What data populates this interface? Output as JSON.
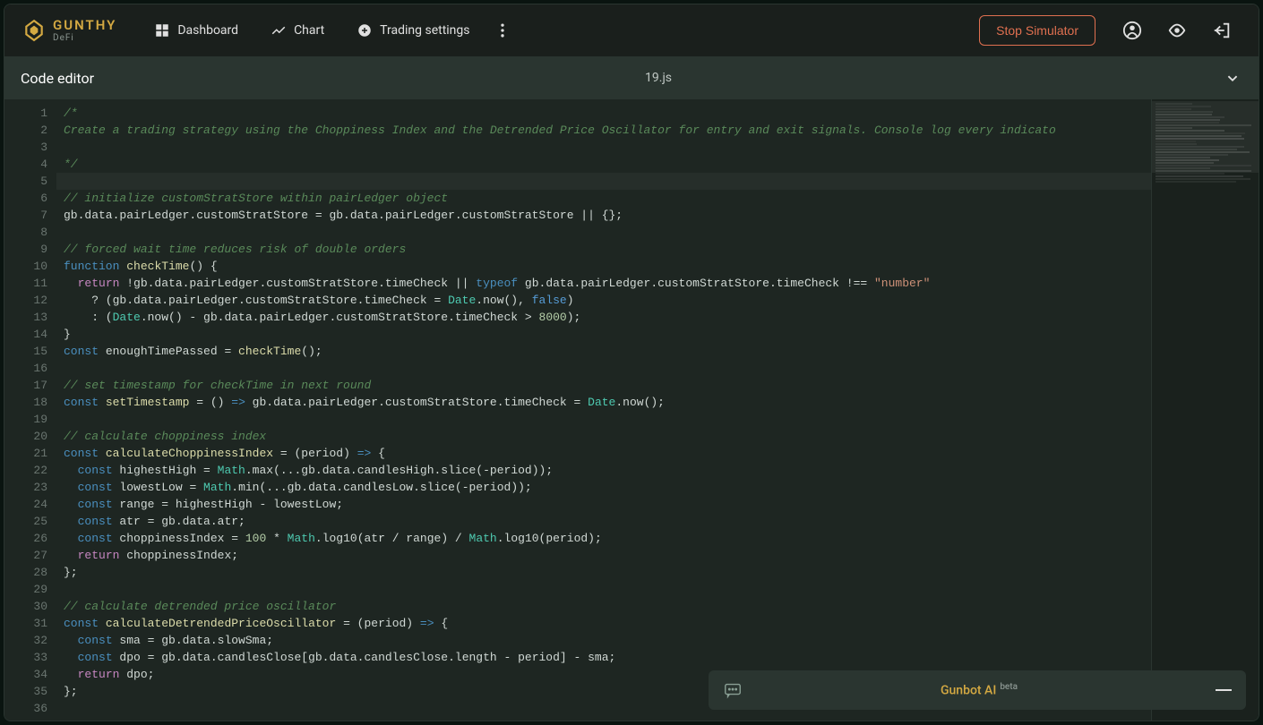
{
  "brand": {
    "main": "GUNTHY",
    "sub": "DeFi"
  },
  "nav": {
    "dashboard": "Dashboard",
    "chart": "Chart",
    "settings": "Trading settings"
  },
  "actions": {
    "stop": "Stop Simulator"
  },
  "editor": {
    "title": "Code editor",
    "filename": "19.js"
  },
  "chat": {
    "label": "Gunbot AI",
    "badge": "beta"
  },
  "code_lines": [
    {
      "n": 1,
      "html": "<span class='tok-comment'>/*</span>"
    },
    {
      "n": 2,
      "html": "<span class='tok-comment'>Create a trading strategy using the Choppiness Index and the Detrended Price Oscillator for entry and exit signals. Console log every indicato</span>"
    },
    {
      "n": 3,
      "html": ""
    },
    {
      "n": 4,
      "html": "<span class='tok-comment'>*/</span>"
    },
    {
      "n": 5,
      "html": "",
      "cursor": true
    },
    {
      "n": 6,
      "html": "<span class='tok-comment'>// initialize customStratStore within pairLedger object</span>"
    },
    {
      "n": 7,
      "html": "gb.data.pairLedger.customStratStore = gb.data.pairLedger.customStratStore || {};"
    },
    {
      "n": 8,
      "html": ""
    },
    {
      "n": 9,
      "html": "<span class='tok-comment'>// forced wait time reduces risk of double orders</span>"
    },
    {
      "n": 10,
      "html": "<span class='tok-keyword'>function</span> <span class='tok-func'>checkTime</span>() {"
    },
    {
      "n": 11,
      "html": "  <span class='tok-keyword2'>return</span> !gb.data.pairLedger.customStratStore.timeCheck || <span class='tok-keyword'>typeof</span> gb.data.pairLedger.customStratStore.timeCheck !== <span class='tok-string'>\"number\"</span>",
      "indent": 1
    },
    {
      "n": 12,
      "html": "    ? (gb.data.pairLedger.customStratStore.timeCheck = <span class='tok-builtin'>Date</span>.now(), <span class='tok-bool'>false</span>)",
      "indent": 1
    },
    {
      "n": 13,
      "html": "    : (<span class='tok-builtin'>Date</span>.now() - gb.data.pairLedger.customStratStore.timeCheck > <span class='tok-number'>8000</span>);",
      "indent": 1
    },
    {
      "n": 14,
      "html": "}"
    },
    {
      "n": 15,
      "html": "<span class='tok-keyword'>const</span> enoughTimePassed = <span class='tok-func'>checkTime</span>();"
    },
    {
      "n": 16,
      "html": ""
    },
    {
      "n": 17,
      "html": "<span class='tok-comment'>// set timestamp for checkTime in next round</span>"
    },
    {
      "n": 18,
      "html": "<span class='tok-keyword'>const</span> <span class='tok-func'>setTimestamp</span> = () <span class='tok-keyword'>=></span> gb.data.pairLedger.customStratStore.timeCheck = <span class='tok-builtin'>Date</span>.now();"
    },
    {
      "n": 19,
      "html": ""
    },
    {
      "n": 20,
      "html": "<span class='tok-comment'>// calculate choppiness index</span>"
    },
    {
      "n": 21,
      "html": "<span class='tok-keyword'>const</span> <span class='tok-func'>calculateChoppinessIndex</span> = (period) <span class='tok-keyword'>=></span> {"
    },
    {
      "n": 22,
      "html": "  <span class='tok-keyword'>const</span> highestHigh = <span class='tok-builtin'>Math</span>.max(...gb.data.candlesHigh.slice(-period));",
      "indent": 1
    },
    {
      "n": 23,
      "html": "  <span class='tok-keyword'>const</span> lowestLow = <span class='tok-builtin'>Math</span>.min(...gb.data.candlesLow.slice(-period));",
      "indent": 1
    },
    {
      "n": 24,
      "html": "  <span class='tok-keyword'>const</span> range = highestHigh - lowestLow;",
      "indent": 1
    },
    {
      "n": 25,
      "html": "  <span class='tok-keyword'>const</span> atr = gb.data.atr;",
      "indent": 1
    },
    {
      "n": 26,
      "html": "  <span class='tok-keyword'>const</span> choppinessIndex = <span class='tok-number'>100</span> * <span class='tok-builtin'>Math</span>.log10(atr / range) / <span class='tok-builtin'>Math</span>.log10(period);",
      "indent": 1
    },
    {
      "n": 27,
      "html": "  <span class='tok-keyword2'>return</span> choppinessIndex;",
      "indent": 1
    },
    {
      "n": 28,
      "html": "};"
    },
    {
      "n": 29,
      "html": ""
    },
    {
      "n": 30,
      "html": "<span class='tok-comment'>// calculate detrended price oscillator</span>"
    },
    {
      "n": 31,
      "html": "<span class='tok-keyword'>const</span> <span class='tok-func'>calculateDetrendedPriceOscillator</span> = (period) <span class='tok-keyword'>=></span> {"
    },
    {
      "n": 32,
      "html": "  <span class='tok-keyword'>const</span> sma = gb.data.slowSma;",
      "indent": 1
    },
    {
      "n": 33,
      "html": "  <span class='tok-keyword'>const</span> dpo = gb.data.candlesClose[gb.data.candlesClose.length - period] - sma;",
      "indent": 1
    },
    {
      "n": 34,
      "html": "  <span class='tok-keyword2'>return</span> dpo;",
      "indent": 1
    },
    {
      "n": 35,
      "html": "};"
    },
    {
      "n": 36,
      "html": ""
    }
  ]
}
